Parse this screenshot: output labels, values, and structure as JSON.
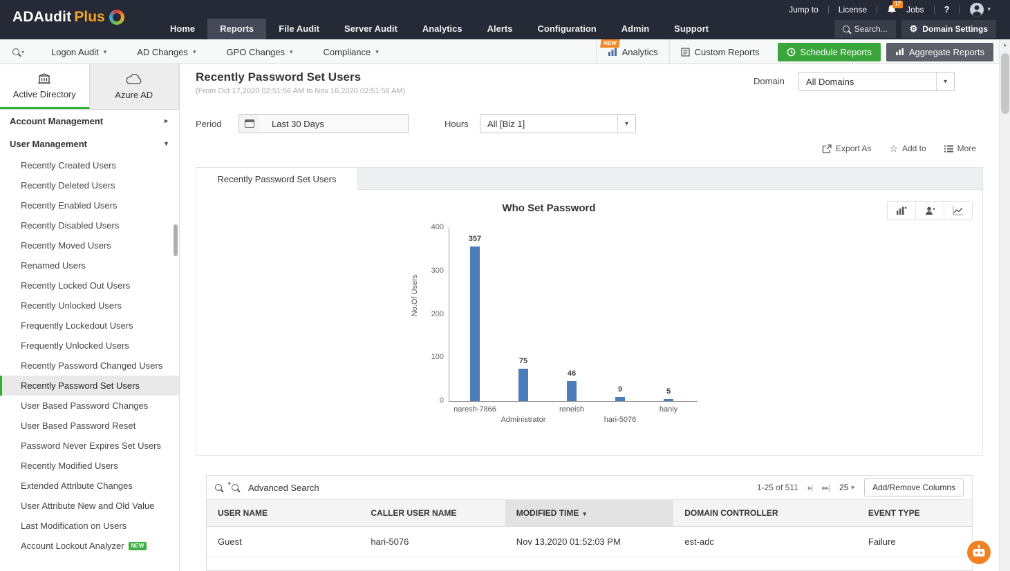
{
  "colors": {
    "dark_header": "#262a36",
    "accent_green": "#2fb32f",
    "button_green": "#3aa53a",
    "brand_orange": "#f5a623",
    "badge_orange": "#f6881f",
    "bar_blue": "#4a7dba"
  },
  "icons": {
    "caret_down": "▾",
    "caret_right": "▸",
    "up_arrow": "▲",
    "gear": "⚙",
    "star": "☆",
    "help": "?",
    "plus": "+",
    "next_page": "▸|",
    "last_page": "▸▸|",
    "sort_desc": "▼"
  },
  "topbar": {
    "logo_brand": "ADAudit",
    "logo_plus": "Plus",
    "utility": {
      "jump_to": "Jump to",
      "license": "License",
      "notification_count": "17",
      "jobs": "Jobs"
    },
    "nav": [
      "Home",
      "Reports",
      "File Audit",
      "Server Audit",
      "Analytics",
      "Alerts",
      "Configuration",
      "Admin",
      "Support"
    ],
    "active_nav": "Reports",
    "search_label": "Search...",
    "domain_settings_label": "Domain Settings"
  },
  "toolbar": {
    "menus": [
      "Logon Audit",
      "AD Changes",
      "GPO Changes",
      "Compliance"
    ],
    "new_badge": "NEW",
    "analytics_label": "Analytics",
    "custom_reports_label": "Custom Reports",
    "schedule_reports_label": "Schedule Reports",
    "aggregate_reports_label": "Aggregate Reports"
  },
  "sidebar": {
    "tabs": [
      "Active Directory",
      "Azure AD"
    ],
    "active_tab": "Active Directory",
    "sections": [
      {
        "label": "Account Management",
        "expanded": false
      },
      {
        "label": "User Management",
        "expanded": true
      }
    ],
    "items": [
      "Recently Created Users",
      "Recently Deleted Users",
      "Recently Enabled Users",
      "Recently Disabled Users",
      "Recently Moved Users",
      "Renamed Users",
      "Recently Locked Out Users",
      "Recently Unlocked Users",
      "Frequently Lockedout Users",
      "Frequently Unlocked Users",
      "Recently Password Changed Users",
      "Recently Password Set Users",
      "User Based Password Changes",
      "User Based Password Reset",
      "Password Never Expires Set Users",
      "Recently Modified Users",
      "Extended Attribute Changes",
      "User Attribute New and Old Value",
      "Last Modification on Users",
      "Account Lockout Analyzer"
    ],
    "selected_item": "Recently Password Set Users",
    "new_badge": "NEW"
  },
  "report": {
    "title": "Recently Password Set Users",
    "date_range": "(From Oct 17,2020 02:51:56 AM to Nov 16,2020 02:51:56 AM)",
    "domain_label": "Domain",
    "domain_value": "All Domains",
    "period_label": "Period",
    "period_value": "Last 30 Days",
    "hours_label": "Hours",
    "hours_value": "All [Biz 1]",
    "export_as_label": "Export As",
    "add_to_label": "Add to",
    "more_label": "More",
    "tab_label": "Recently Password Set Users"
  },
  "chart_data": {
    "type": "bar",
    "title": "Who Set Password",
    "ylabel": "No.Of Users",
    "categories": [
      "naresh-7866",
      "Administrator",
      "reneish",
      "hari-5076",
      "haniy"
    ],
    "values": [
      357,
      75,
      46,
      9,
      5
    ],
    "ylim": [
      0,
      400
    ],
    "yticks": [
      0,
      100,
      200,
      300,
      400
    ],
    "bar_color": "#4a7dba",
    "grid": false,
    "legend": "none"
  },
  "table": {
    "advanced_search_label": "Advanced Search",
    "pagination_text": "1-25 of 511",
    "page_size": "25",
    "add_remove_columns_label": "Add/Remove Columns",
    "columns": [
      "USER NAME",
      "CALLER USER NAME",
      "MODIFIED TIME",
      "DOMAIN CONTROLLER",
      "EVENT TYPE"
    ],
    "sorted_column": "MODIFIED TIME",
    "sort_direction": "desc",
    "rows": [
      {
        "user_name": "Guest",
        "caller_user_name": "hari-5076",
        "modified_time": "Nov 13,2020 01:52:03 PM",
        "domain_controller": "est-adc",
        "event_type": "Failure"
      }
    ]
  }
}
